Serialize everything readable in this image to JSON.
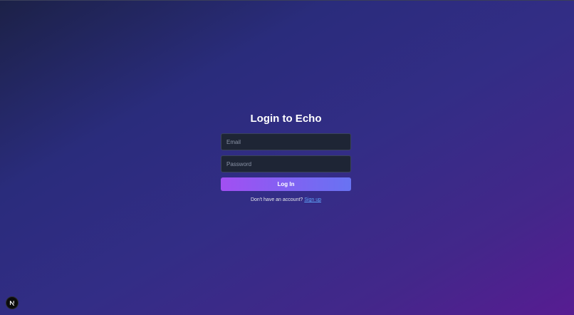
{
  "page": {
    "title": "Login to Echo"
  },
  "form": {
    "email_placeholder": "Email",
    "password_placeholder": "Password",
    "submit_label": "Log In"
  },
  "signup": {
    "prompt": "Don't have an account?",
    "link_label": "Sign up"
  },
  "dev_badge": {
    "icon": "nextjs-icon"
  },
  "colors": {
    "background_start": "#1c2147",
    "background_end": "#571c92",
    "button_start": "#a24ff2",
    "button_end": "#6873f2",
    "link": "#60a5fa",
    "field_background": "#1e2535"
  }
}
